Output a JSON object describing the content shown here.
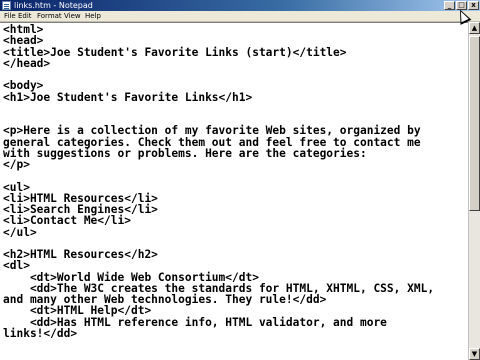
{
  "window": {
    "title": "links.htm - Notepad",
    "minimize_glyph": "_",
    "maximize_glyph": "□",
    "close_glyph": "x"
  },
  "menu": {
    "items": [
      "File",
      "Edit",
      "Format",
      "View",
      "Help"
    ]
  },
  "editor": {
    "text": "<html>\n<head>\n<title>Joe Student's Favorite Links (start)</title>\n</head>\n\n<body>\n<h1>Joe Student's Favorite Links</h1>\n\n\n<p>Here is a collection of my favorite Web sites, organized by\ngeneral categories. Check them out and feel free to contact me\nwith suggestions or problems. Here are the categories:\n</p>\n\n<ul>\n<li>HTML Resources</li>\n<li>Search Engines</li>\n<li>Contact Me</li>\n</ul>\n\n<h2>HTML Resources</h2>\n<dl>\n    <dt>World Wide Web Consortium</dt>\n    <dd>The W3C creates the standards for HTML, XHTML, CSS, XML,\nand many other Web technologies. They rule!</dd>\n    <dt>HTML Help</dt>\n    <dd>Has HTML reference info, HTML validator, and more\nlinks!</dd>"
  },
  "scrollbar": {
    "up_glyph": "▲",
    "down_glyph": "▼"
  }
}
